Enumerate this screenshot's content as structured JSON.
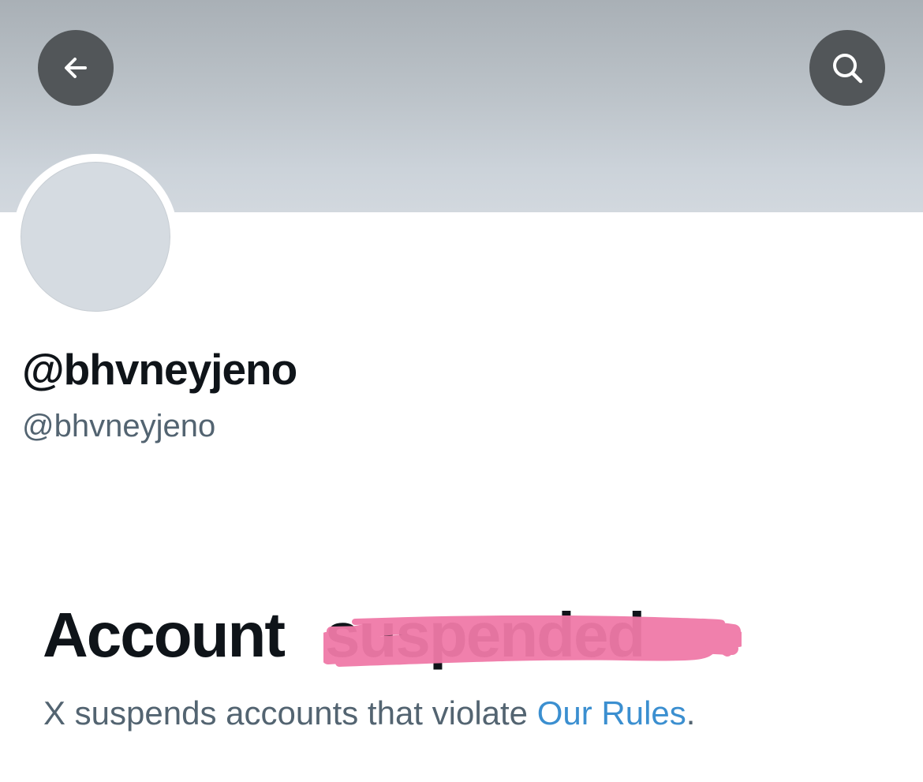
{
  "header": {
    "back_icon": "arrow-left-icon",
    "search_icon": "search-icon"
  },
  "profile": {
    "display_name": "@bhvneyjeno",
    "handle": "@bhvneyjeno"
  },
  "notice": {
    "heading": "Account",
    "scribbled_word": "suspended",
    "message_prefix": "X suspends accounts that violate ",
    "link_text": "Our Rules",
    "message_suffix": "."
  },
  "colors": {
    "banner": "#bcc3c9",
    "button_bg": "#525659",
    "avatar": "#d5dbe1",
    "text_primary": "#0f1419",
    "text_secondary": "#536471",
    "link": "#3b8fd0",
    "scribble": "#f07aa8"
  }
}
